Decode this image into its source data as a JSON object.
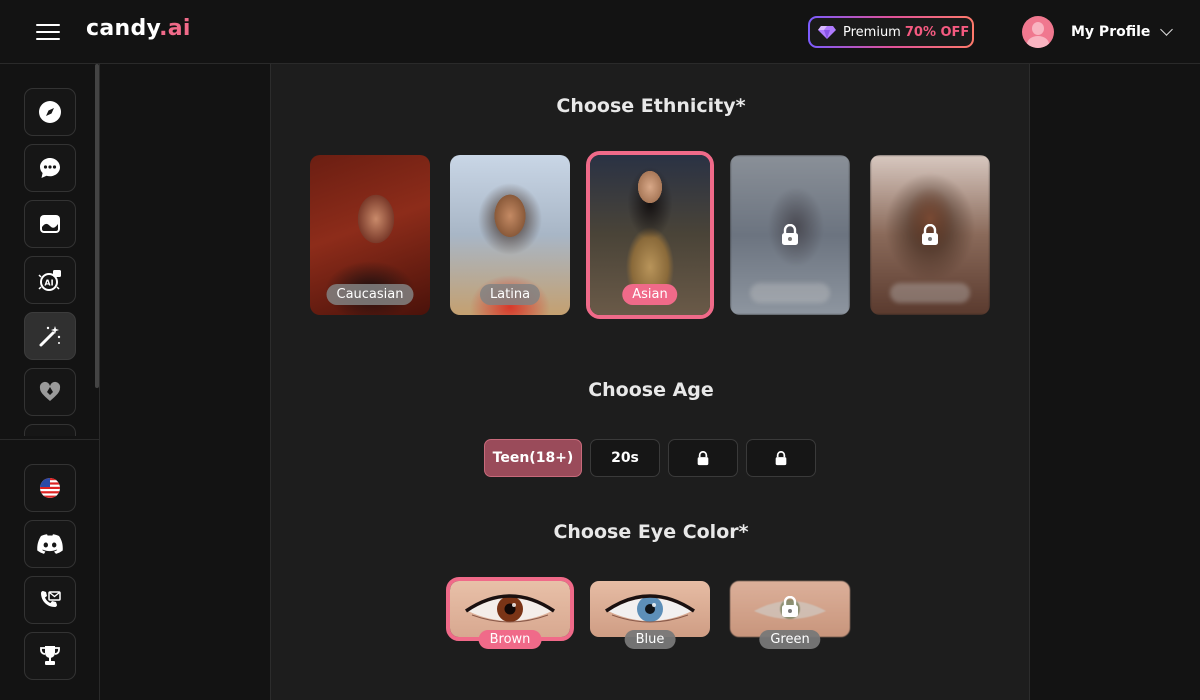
{
  "header": {
    "logo_main": "candy",
    "logo_accent": ".ai",
    "premium_label": "Premium",
    "premium_discount": "70% OFF",
    "profile_name": "My Profile"
  },
  "sidebar": {
    "top_items": [
      "explore-icon",
      "chat-icon",
      "gallery-icon",
      "ai-generate-icon",
      "magic-wand-icon",
      "heart-icon"
    ],
    "bottom_items": [
      "us-flag-icon",
      "discord-icon",
      "mail-icon",
      "trophy-icon"
    ],
    "active": "magic-wand-icon"
  },
  "ethnicity": {
    "title": "Choose Ethnicity*",
    "options": [
      {
        "label": "Caucasian",
        "locked": false,
        "selected": false
      },
      {
        "label": "Latina",
        "locked": false,
        "selected": false
      },
      {
        "label": "Asian",
        "locked": false,
        "selected": true
      },
      {
        "label": "",
        "locked": true,
        "selected": false
      },
      {
        "label": "",
        "locked": true,
        "selected": false
      }
    ]
  },
  "age": {
    "title": "Choose Age",
    "options": [
      {
        "label": "Teen(18+)",
        "locked": false,
        "selected": true
      },
      {
        "label": "20s",
        "locked": false,
        "selected": false
      },
      {
        "label": "",
        "locked": true,
        "selected": false
      },
      {
        "label": "",
        "locked": true,
        "selected": false
      }
    ]
  },
  "eye_color": {
    "title": "Choose Eye Color*",
    "options": [
      {
        "label": "Brown",
        "locked": false,
        "selected": true,
        "iris": "#7a3416"
      },
      {
        "label": "Blue",
        "locked": false,
        "selected": false,
        "iris": "#5d8fb8"
      },
      {
        "label": "Green",
        "locked": true,
        "selected": false,
        "iris": "#6d7a55"
      }
    ]
  },
  "colors": {
    "accent": "#f06a89",
    "background": "#131313",
    "panel": "#1d1d1d"
  }
}
